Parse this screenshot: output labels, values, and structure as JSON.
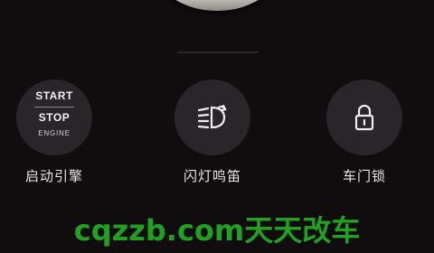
{
  "controls": [
    {
      "label": "启动引擎",
      "icon": "engine-start-stop-icon",
      "icon_text": {
        "start": "START",
        "stop": "STOP",
        "engine": "ENGINE"
      }
    },
    {
      "label": "闪灯鸣笛",
      "icon": "flash-horn-icon"
    },
    {
      "label": "车门锁",
      "icon": "lock-icon"
    }
  ],
  "watermark": "cqzzb.com天天改车",
  "colors": {
    "background": "#110d0f",
    "circle": "#2a2528",
    "text": "#e8e6e7",
    "watermark": "#1fa31f"
  }
}
